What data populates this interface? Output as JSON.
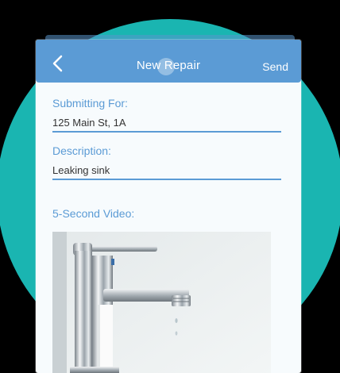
{
  "header": {
    "back_icon": "chevron-left-icon",
    "title": "New Repair",
    "send_label": "Send"
  },
  "form": {
    "submitting_for_label": "Submitting For:",
    "submitting_for_value": "125 Main St, 1A",
    "description_label": "Description:",
    "description_value": "Leaking sink",
    "video_label": "5-Second Video:"
  },
  "colors": {
    "accent": "#5b9bd5",
    "background_circle": "#1ab5b1",
    "page_background": "#000000"
  }
}
